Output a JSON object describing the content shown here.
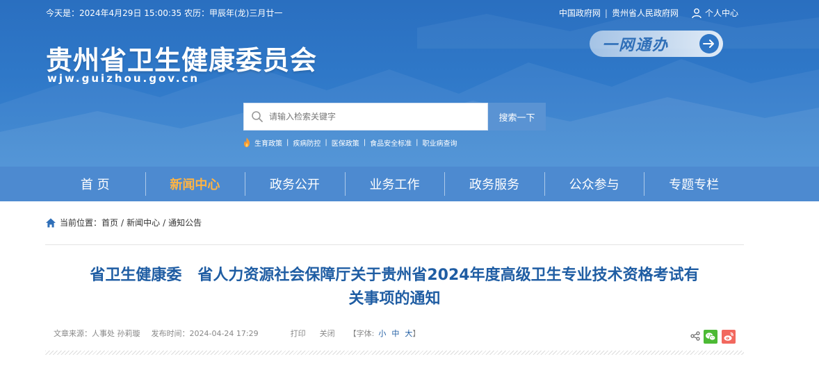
{
  "topbar": {
    "datetime": "今天是：2024年4月29日  15:00:35  农历：甲辰年(龙)三月廿一",
    "links": [
      "中国政府网",
      "贵州省人民政府网"
    ],
    "user_center": "个人中心"
  },
  "site": {
    "title": "贵州省卫生健康委员会",
    "domain": "wjw.guizhou.gov.cn"
  },
  "ywtb": {
    "label": "一网通办"
  },
  "search": {
    "placeholder": "请输入检索关键字",
    "button": "搜索一下"
  },
  "hotwords": [
    "生育政策",
    "疾病防控",
    "医保政策",
    "食品安全标准",
    "职业病查询"
  ],
  "nav": {
    "items": [
      {
        "label": "首  页",
        "active": false
      },
      {
        "label": "新闻中心",
        "active": true
      },
      {
        "label": "政务公开",
        "active": false
      },
      {
        "label": "业务工作",
        "active": false
      },
      {
        "label": "政务服务",
        "active": false
      },
      {
        "label": "公众参与",
        "active": false
      },
      {
        "label": "专题专栏",
        "active": false
      }
    ]
  },
  "breadcrumb": {
    "prefix": "当前位置：",
    "items": [
      "首页",
      "新闻中心",
      "通知公告"
    ]
  },
  "article": {
    "title_line1": "省卫生健康委   省人力资源社会保障厅关于贵州省2024年度高级卫生专业技术资格考试有",
    "title_line2": "关事项的通知",
    "source": "文章来源：人事处 孙莉璇",
    "published": "发布时间：2024-04-24 17:29",
    "print": "打印",
    "close": "关闭",
    "font_label": "【字体:",
    "font_small": "小",
    "font_medium": "中",
    "font_large": "大",
    "font_end": "】"
  },
  "colors": {
    "header_blue": "#2f78c8",
    "nav_blue": "#4d8ad0",
    "active_orange": "#ffb443",
    "title_blue": "#1f5da3"
  }
}
